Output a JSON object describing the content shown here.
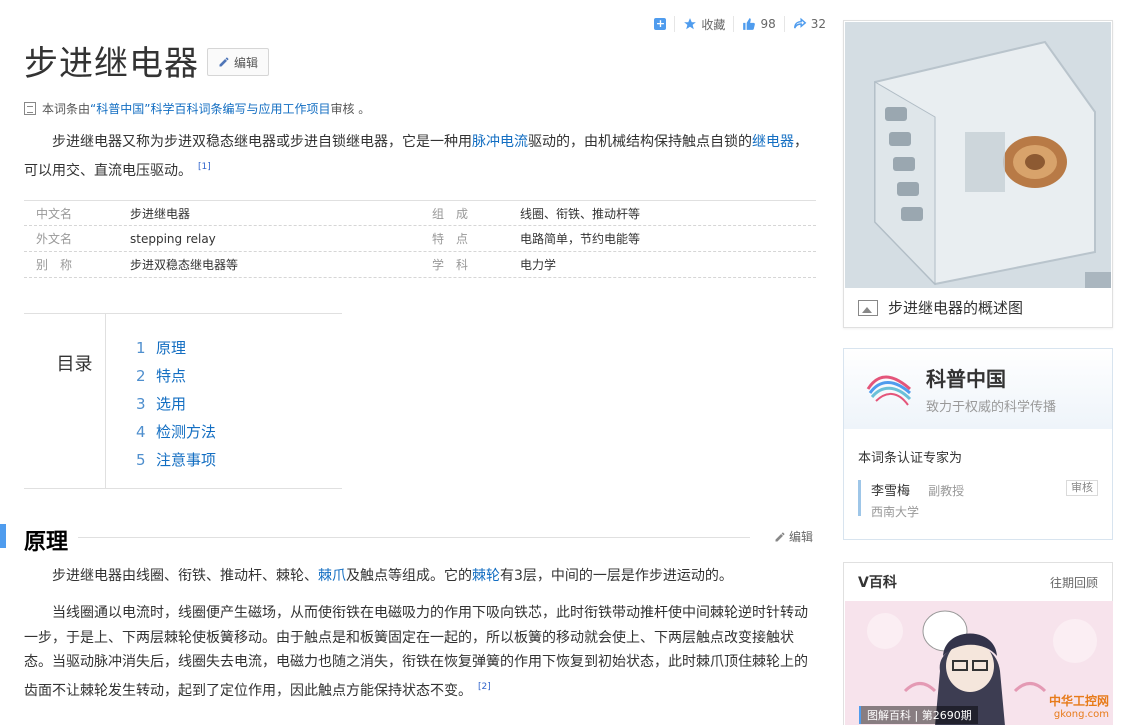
{
  "header": {
    "title": "步进继电器",
    "edit_label": "编辑",
    "actions": {
      "collect_label": "收藏",
      "like_count": "98",
      "share_count": "32"
    }
  },
  "source": {
    "prefix": "本词条由",
    "link": "“科普中国”科学百科词条编写与应用工作项目",
    "suffix": " 审核 。"
  },
  "intro": {
    "text_1": "步进继电器又称为步进双稳态继电器或步进自锁继电器，它是一种用",
    "link_1": "脉冲电流",
    "text_2": "驱动的，由机械结构保持触点自锁的",
    "link_2": "继电器",
    "text_3": "，可以用交、直流电压驱动。",
    "ref": "[1]"
  },
  "basic_info": [
    {
      "name": "中文名",
      "value": "步进继电器",
      "name2": "组　成",
      "value2": "线圈、衔铁、推动杆等"
    },
    {
      "name": "外文名",
      "value": "stepping relay",
      "name2": "特　点",
      "value2": "电路简单，节约电能等"
    },
    {
      "name": "别　称",
      "value": "步进双稳态继电器等",
      "name2": "学　科",
      "value2": "电力学"
    }
  ],
  "toc": {
    "title": "目录",
    "items": [
      {
        "num": "1",
        "label": "原理"
      },
      {
        "num": "2",
        "label": "特点"
      },
      {
        "num": "3",
        "label": "选用"
      },
      {
        "num": "4",
        "label": "检测方法"
      },
      {
        "num": "5",
        "label": "注意事项"
      }
    ]
  },
  "section": {
    "title": "原理",
    "edit_label": "编辑",
    "p1_text_1": "步进继电器由线圈、衔铁、推动杆、棘轮、",
    "p1_link_1": "棘爪",
    "p1_text_2": "及触点等组成。它的",
    "p1_link_2": "棘轮",
    "p1_text_3": "有3层，中间的一层是作步进运动的。",
    "p2_text": "当线圈通以电流时，线圈便产生磁场，从而使衔铁在电磁吸力的作用下吸向铁芯，此时衔铁带动推杆使中间棘轮逆时针转动一步，于是上、下两层棘轮使板簧移动。由于触点是和板簧固定在一起的，所以板簧的移动就会使上、下两层触点改变接触状态。当驱动脉冲消失后，线圈失去电流，电磁力也随之消失，衔铁在恢复弹簧的作用下恢复到初始状态，此时棘爪顶住棘轮上的齿面不让棘轮发生转动，起到了定位作用，因此触点方能保持状态不变。",
    "p2_ref": "[2]"
  },
  "sidebar": {
    "album_caption": "步进继电器的概述图",
    "expert": {
      "brand": "科普中国",
      "slogan": "致力于权威的科学传播",
      "heading": "本词条认证专家为",
      "name": "李雪梅",
      "title": "副教授",
      "org": "西南大学",
      "badge": "审核"
    },
    "vbaike": {
      "title": "V百科",
      "more": "往期回顾",
      "caption": "图解百科 | 第2690期",
      "watermark_1": "中华工控网",
      "watermark_2": "gkong.com"
    }
  },
  "colors": {
    "link": "#136ec2",
    "accent": "#4f9cee"
  }
}
